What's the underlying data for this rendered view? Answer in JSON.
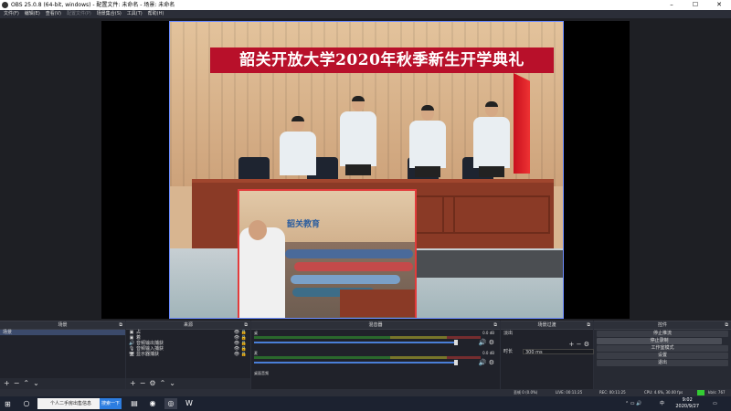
{
  "window": {
    "title": "OBS 25.0.8 (64-bit, windows) - 配置文件: 未命名 - 场景: 未命名",
    "minimize": "–",
    "maximize": "☐",
    "close": "✕"
  },
  "menu": {
    "items": [
      {
        "label": "文件(F)",
        "enabled": true
      },
      {
        "label": "编辑(E)",
        "enabled": true
      },
      {
        "label": "查看(V)",
        "enabled": true
      },
      {
        "label": "配置文件(P)",
        "enabled": false
      },
      {
        "label": "场景集合(S)",
        "enabled": true
      },
      {
        "label": "工具(T)",
        "enabled": true
      },
      {
        "label": "帮助(H)",
        "enabled": true
      }
    ]
  },
  "preview": {
    "banner": "韶关开放大学2020年秋季新生开学典礼",
    "pip_sign": "韶关教育"
  },
  "docks": {
    "scenes": {
      "title": "场景",
      "items": [
        "场景"
      ]
    },
    "sources": {
      "title": "来源",
      "items": [
        {
          "icon": "▣",
          "label": "占",
          "visible": true,
          "locked": true
        },
        {
          "icon": "▣",
          "label": "着",
          "visible": true,
          "locked": true
        },
        {
          "icon": "🔊",
          "label": "音频输出捕获",
          "visible": true,
          "locked": true
        },
        {
          "icon": "🎙",
          "label": "音频输入捕获",
          "visible": true,
          "locked": true
        },
        {
          "icon": "🖥",
          "label": "显示器捕获",
          "visible": true,
          "locked": true
        }
      ]
    },
    "mixer": {
      "title": "混音器",
      "channels": [
        {
          "label": "桌",
          "db": "0.0 dB"
        },
        {
          "label": "麦",
          "db": "0.0 dB"
        },
        {
          "label": "桌面音频",
          "db": ""
        }
      ]
    },
    "transitions": {
      "title": "场景过渡",
      "type": "淡出",
      "duration_label": "时长",
      "duration": "300 ms"
    },
    "controls": {
      "title": "控件",
      "buttons": [
        "停止推流",
        "停止录制",
        "工作室模式",
        "设置",
        "退出"
      ]
    }
  },
  "status": {
    "dropped": "丢帧 0 (0.0%)",
    "live": "LIVE: 00:11:25",
    "rec": "REC: 00:11:25",
    "cpu": "CPU: 4.6%, 30.00 fps",
    "bitrate": "kb/s: 767"
  },
  "taskbar": {
    "search_text": "个人二手房出售信息",
    "search_button": "搜索一下",
    "tray_lang": "中",
    "time": "9:02",
    "date": "2020/9/27"
  }
}
